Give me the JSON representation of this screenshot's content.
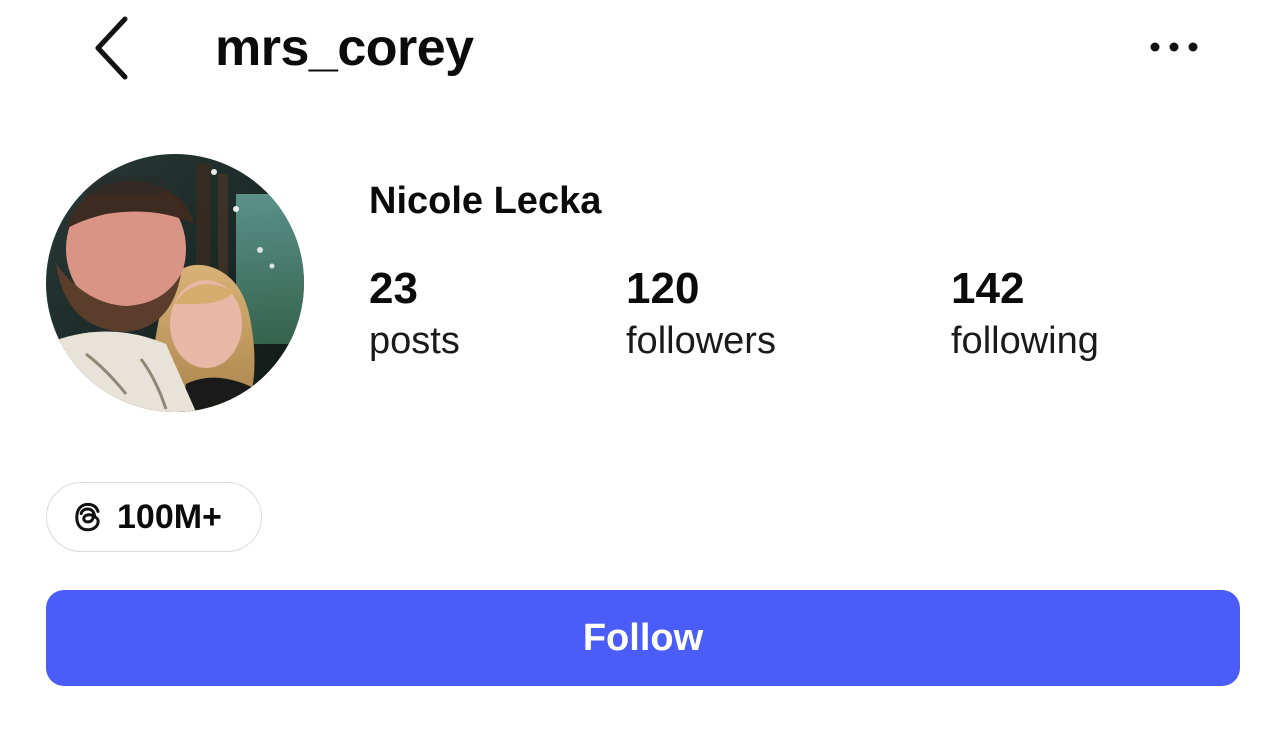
{
  "header": {
    "username": "mrs_corey",
    "back_icon": "chevron-left-icon",
    "more_icon": "more-horizontal-icon"
  },
  "profile": {
    "display_name": "Nicole Lecka",
    "avatar": "profile-photo"
  },
  "stats": [
    {
      "count": "23",
      "label": "posts"
    },
    {
      "count": "120",
      "label": "followers"
    },
    {
      "count": "142",
      "label": "following"
    }
  ],
  "threads_badge": {
    "icon": "threads-icon",
    "count": "100M+"
  },
  "actions": {
    "follow_label": "Follow"
  },
  "colors": {
    "accent": "#4a5df9",
    "text": "#0b0b0b",
    "badge_border": "#dbdbdb"
  }
}
